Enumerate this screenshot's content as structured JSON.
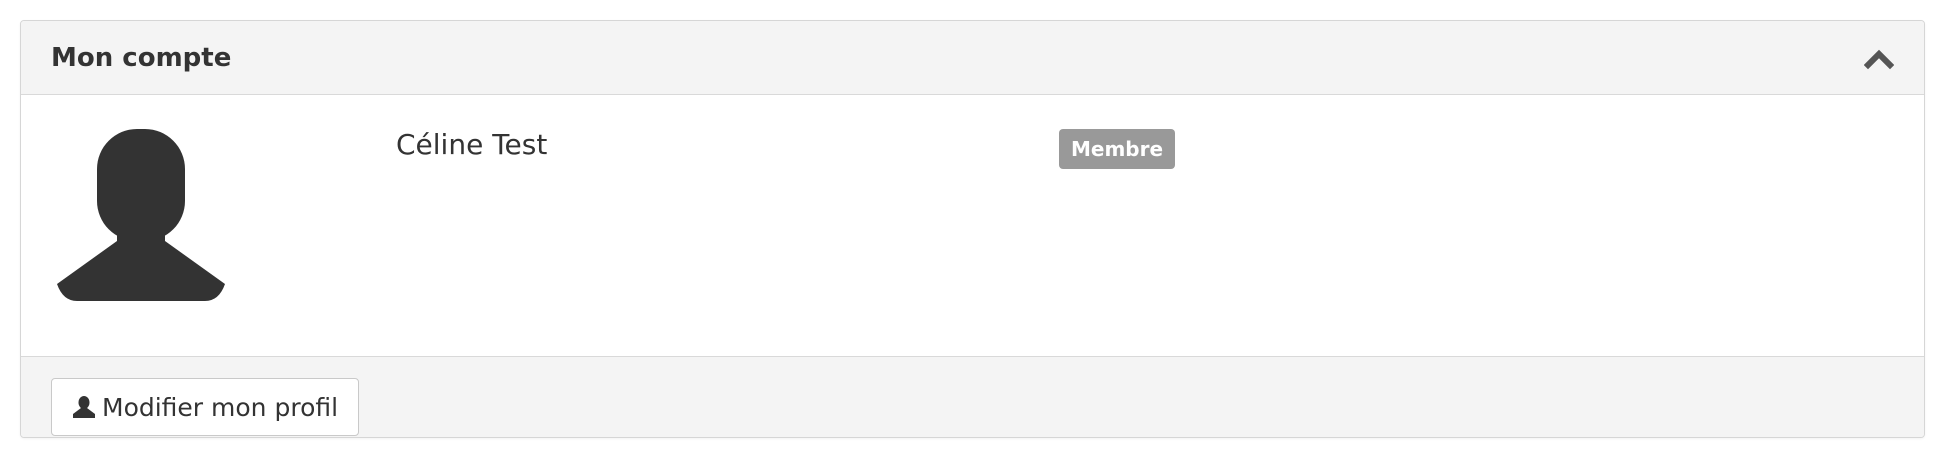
{
  "panel": {
    "title": "Mon compte",
    "collapse_icon": "chevron-up-icon"
  },
  "profile": {
    "avatar_icon": "user-silhouette-icon",
    "name": "Céline Test",
    "role_badge": "Membre"
  },
  "footer": {
    "edit_button_icon": "user-icon",
    "edit_button_label": "Modifier mon profil"
  },
  "colors": {
    "panel_header_bg": "#f4f4f4",
    "badge_bg": "#999999",
    "text": "#333333",
    "avatar": "#333333"
  }
}
